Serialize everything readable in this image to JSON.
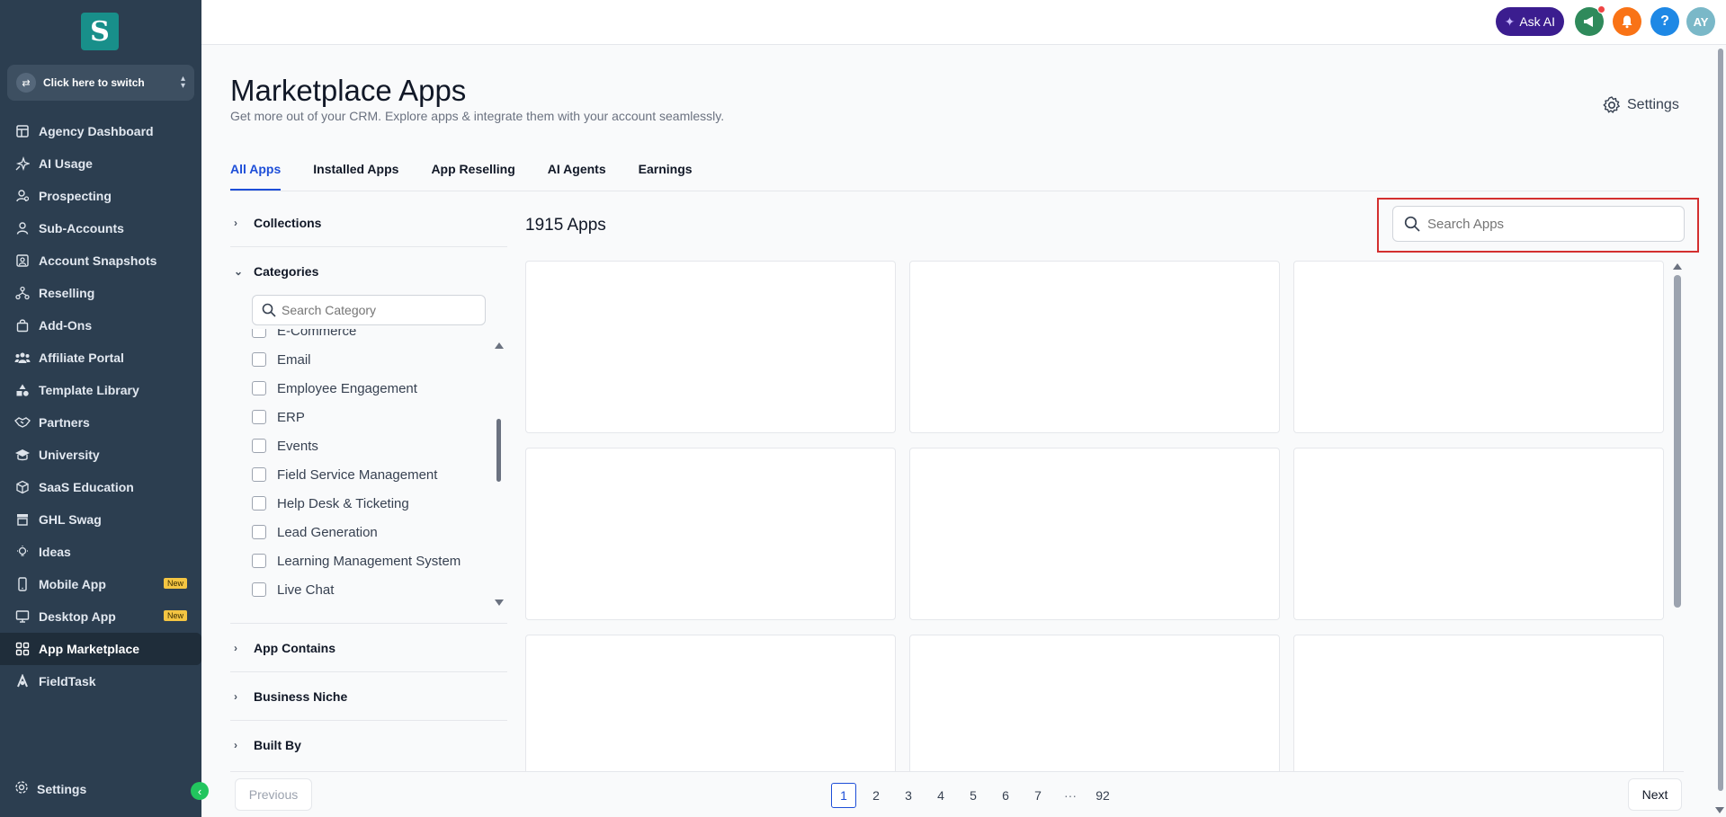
{
  "sidebar": {
    "logo_letter": "S",
    "switcher_label": "Click here to switch",
    "items": [
      {
        "label": "Agency Dashboard",
        "icon": "dashboard-icon"
      },
      {
        "label": "AI Usage",
        "icon": "ai-sparkle-icon"
      },
      {
        "label": "Prospecting",
        "icon": "prospecting-icon"
      },
      {
        "label": "Sub-Accounts",
        "icon": "user-icon"
      },
      {
        "label": "Account Snapshots",
        "icon": "snapshot-icon"
      },
      {
        "label": "Reselling",
        "icon": "reselling-icon"
      },
      {
        "label": "Add-Ons",
        "icon": "bag-icon"
      },
      {
        "label": "Affiliate Portal",
        "icon": "users-icon"
      },
      {
        "label": "Template Library",
        "icon": "shapes-icon"
      },
      {
        "label": "Partners",
        "icon": "handshake-icon"
      },
      {
        "label": "University",
        "icon": "graduation-cap-icon"
      },
      {
        "label": "SaaS Education",
        "icon": "cubes-icon"
      },
      {
        "label": "GHL Swag",
        "icon": "store-icon"
      },
      {
        "label": "Ideas",
        "icon": "lightbulb-icon"
      },
      {
        "label": "Mobile App",
        "icon": "mobile-icon",
        "badge": "New"
      },
      {
        "label": "Desktop App",
        "icon": "desktop-icon",
        "badge": "New"
      },
      {
        "label": "App Marketplace",
        "icon": "grid-icon",
        "active": true
      },
      {
        "label": "FieldTask",
        "icon": "fieldtask-icon"
      }
    ],
    "settings_label": "Settings"
  },
  "topbar": {
    "ask_ai_label": "Ask AI",
    "help_symbol": "?",
    "avatar_initials": "AY"
  },
  "header": {
    "title": "Marketplace Apps",
    "subtitle": "Get more out of your CRM. Explore apps & integrate them with your account seamlessly.",
    "settings_label": "Settings"
  },
  "tabs": [
    {
      "label": "All Apps",
      "active": true
    },
    {
      "label": "Installed Apps"
    },
    {
      "label": "App Reselling"
    },
    {
      "label": "AI Agents"
    },
    {
      "label": "Earnings"
    }
  ],
  "filters": {
    "collections_label": "Collections",
    "categories_label": "Categories",
    "category_search_placeholder": "Search Category",
    "categories": [
      "E-Commerce",
      "Email",
      "Employee Engagement",
      "ERP",
      "Events",
      "Field Service Management",
      "Help Desk & Ticketing",
      "Lead Generation",
      "Learning Management System",
      "Live Chat"
    ],
    "app_contains_label": "App Contains",
    "business_niche_label": "Business Niche",
    "built_by_label": "Built By"
  },
  "main": {
    "apps_count": "1915 Apps",
    "search_placeholder": "Search Apps"
  },
  "pagination": {
    "previous_label": "Previous",
    "next_label": "Next",
    "pages": [
      "1",
      "2",
      "3",
      "4",
      "5",
      "6",
      "7"
    ],
    "ellipsis": "···",
    "last_page": "92",
    "current_page": "1"
  },
  "colors": {
    "sidebar_bg": "#2c3e50",
    "accent": "#1d4ed8",
    "highlight_border": "#d32f2f",
    "ask_ai_bg": "#3b1d8f"
  }
}
